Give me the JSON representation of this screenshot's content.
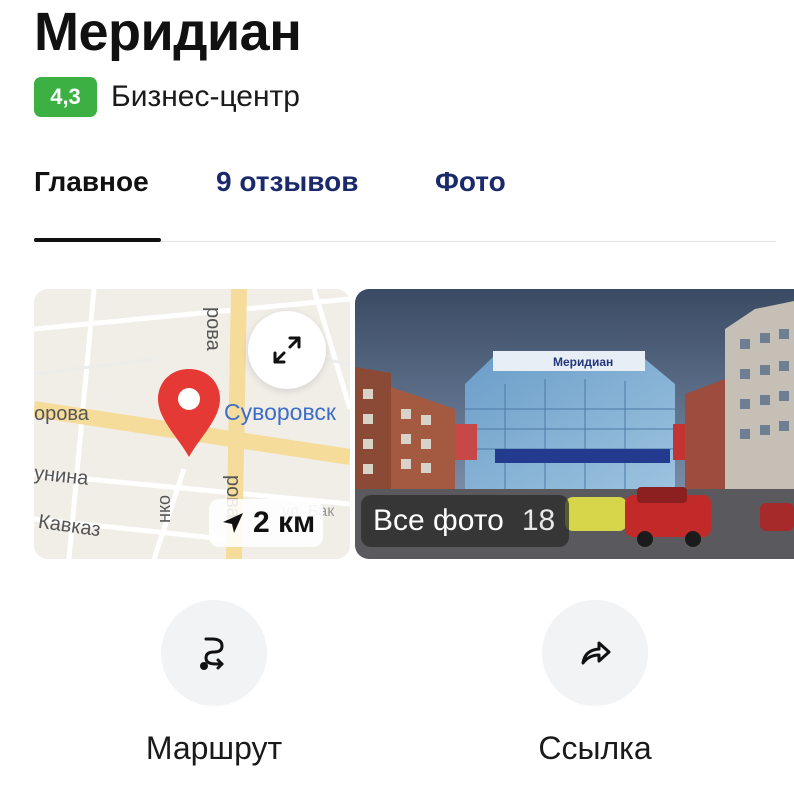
{
  "place": {
    "title": "Меридиан",
    "rating": "4,3",
    "category": "Бизнес-центр"
  },
  "tabs": [
    {
      "label": "Главное",
      "active": true
    },
    {
      "label": "9 отзывов",
      "active": false
    },
    {
      "label": "Фото",
      "active": false
    }
  ],
  "map": {
    "street_labels": [
      "орова",
      "Суворовск",
      "унина",
      "Кавказ",
      "рова",
      "рова",
      "ул. Бак",
      "нко"
    ],
    "distance": "2 км",
    "expand_icon": "expand-arrows-icon",
    "pin_icon": "map-pin-icon",
    "direction_icon": "navigation-arrow-icon"
  },
  "photos": {
    "label": "Все фото",
    "count": "18"
  },
  "actions": [
    {
      "label": "Маршрут",
      "icon": "route-icon"
    },
    {
      "label": "Ссылка",
      "icon": "share-arrow-icon"
    }
  ],
  "colors": {
    "rating_badge": "#3cb043",
    "tab_link": "#1b2a6b",
    "map_pin": "#e53935",
    "map_street_label": "#3e6ec8",
    "action_circle": "#f2f3f5"
  }
}
